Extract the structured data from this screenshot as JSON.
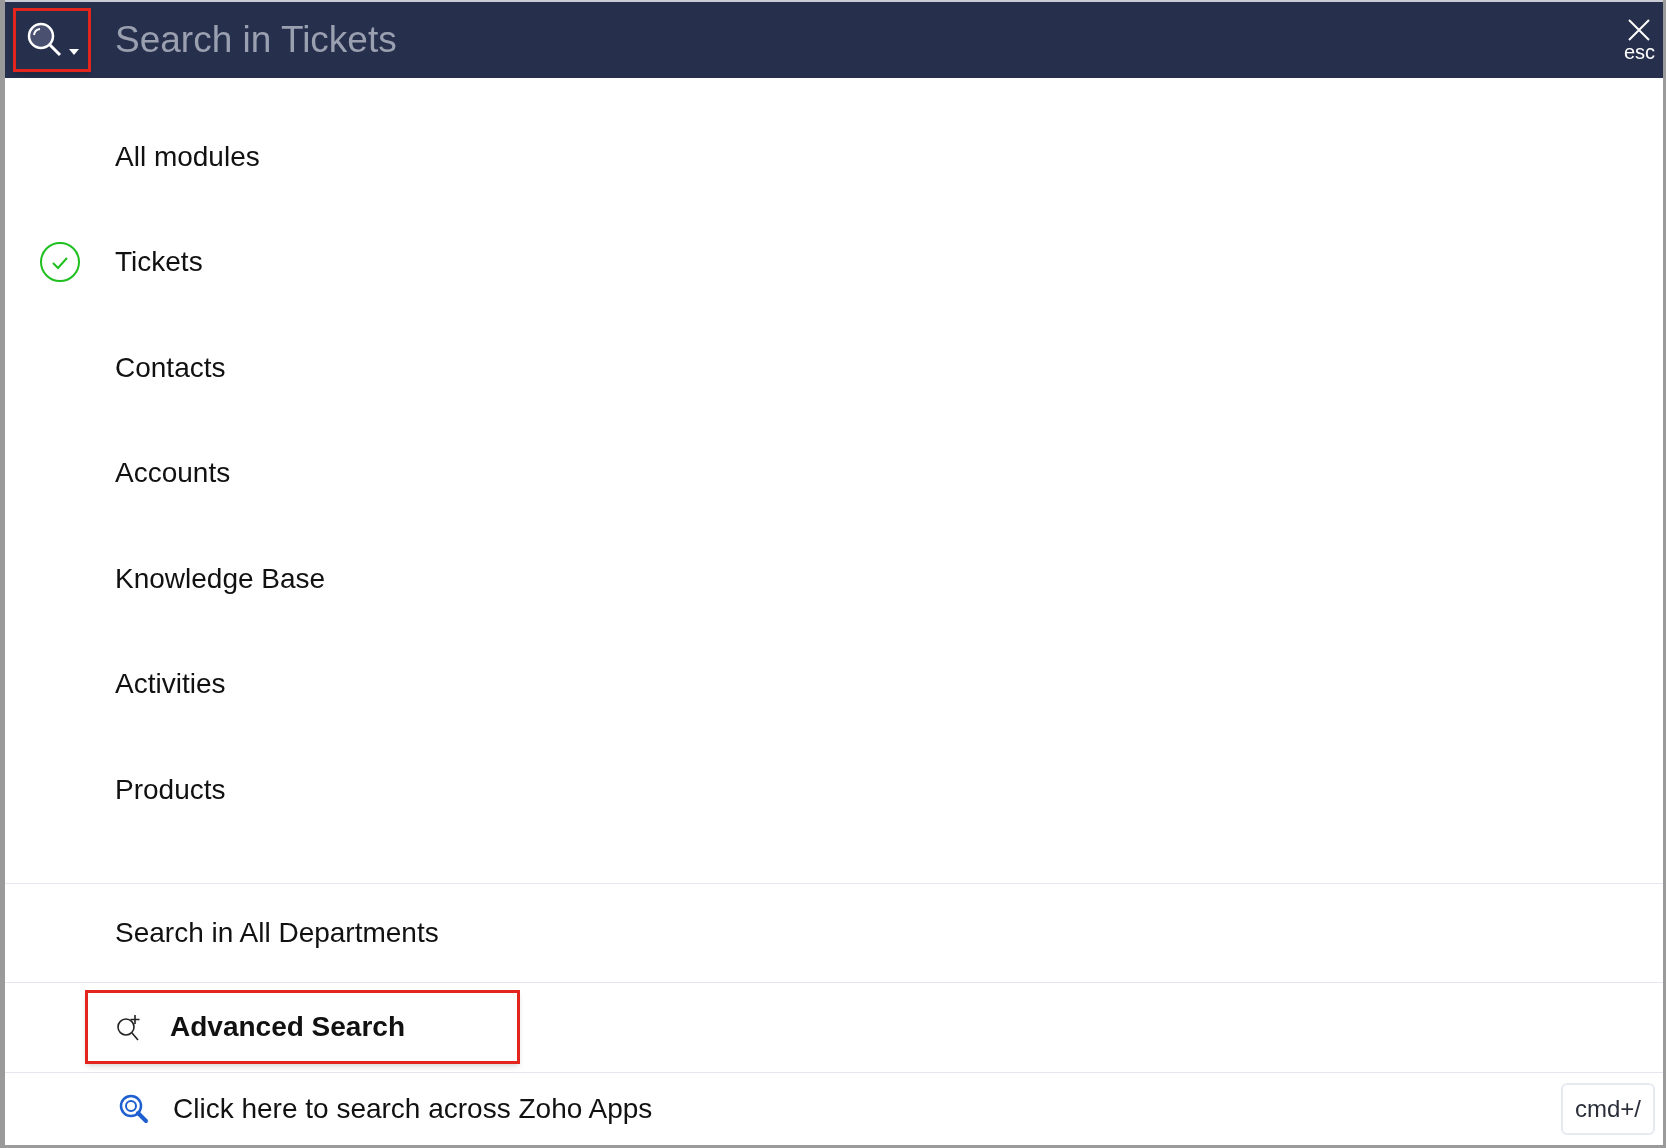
{
  "search_bar": {
    "placeholder": "Search in Tickets",
    "scope_button_highlighted": true,
    "close_label": "esc"
  },
  "modules": [
    {
      "label": "All modules",
      "selected": false
    },
    {
      "label": "Tickets",
      "selected": true
    },
    {
      "label": "Contacts",
      "selected": false
    },
    {
      "label": "Accounts",
      "selected": false
    },
    {
      "label": "Knowledge Base",
      "selected": false
    },
    {
      "label": "Activities",
      "selected": false
    },
    {
      "label": "Products",
      "selected": false
    }
  ],
  "all_departments": {
    "label": "Search in All Departments"
  },
  "advanced_search": {
    "label": "Advanced Search",
    "highlighted": true
  },
  "zoho_search": {
    "label": "Click here to search across Zoho Apps",
    "shortcut": "cmd+/"
  }
}
